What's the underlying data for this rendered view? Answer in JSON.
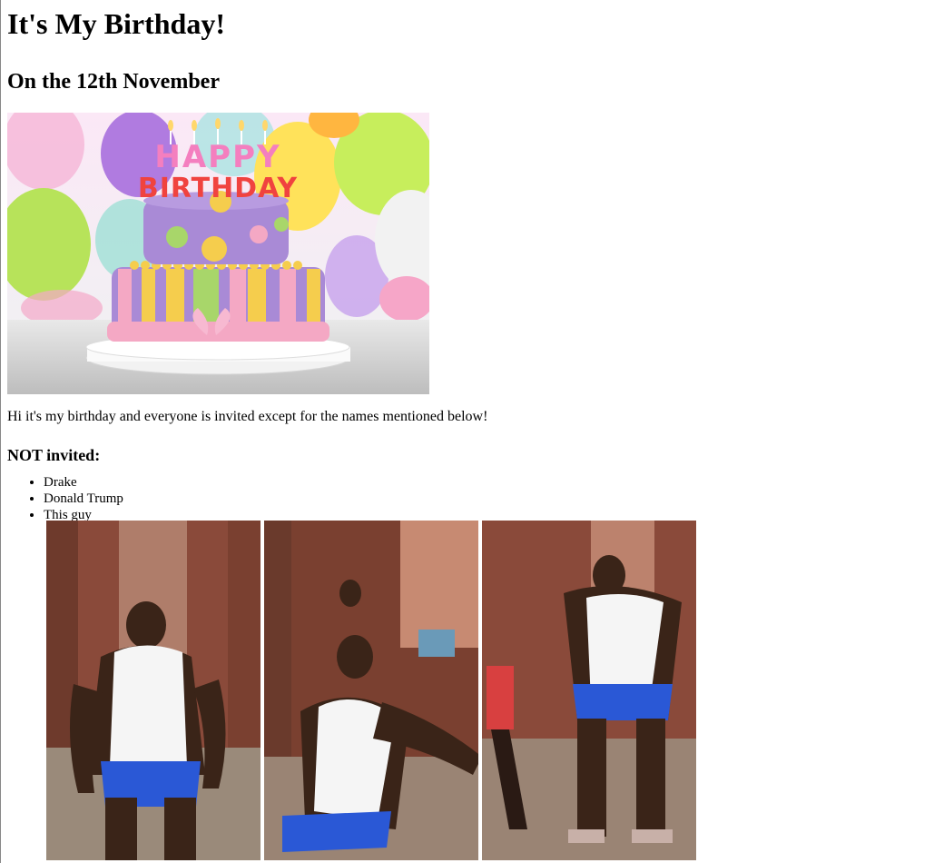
{
  "page": {
    "title": "It's My Birthday!",
    "subtitle": "On the 12th November",
    "intro": "Hi it's my birthday and everyone is invited except for the names mentioned below!",
    "not_invited_heading": "NOT invited:",
    "not_invited": [
      "Drake",
      "Donald Trump",
      "This guy"
    ]
  },
  "cake_image": {
    "topper_line1": "HAPPY",
    "topper_line2": "BIRTHDAY",
    "colors": {
      "balloon_purple": "#b07be0",
      "balloon_green": "#b7e35a",
      "balloon_yellow": "#ffe25a",
      "balloon_pink": "#f6a6c8",
      "cake_purple": "#a98ad6",
      "ribbon_pink": "#f4a8c4",
      "stripe_yellow": "#f5cd4d",
      "stripe_green": "#a8d66a",
      "board_white": "#f2f2f2"
    }
  },
  "guy_image": {
    "panels": 3,
    "colors": {
      "brick": "#8a4a3a",
      "shirt": "#f5f5f5",
      "shorts": "#2a58d6",
      "skin": "#3a2418",
      "ground": "#9a8a7a"
    }
  }
}
